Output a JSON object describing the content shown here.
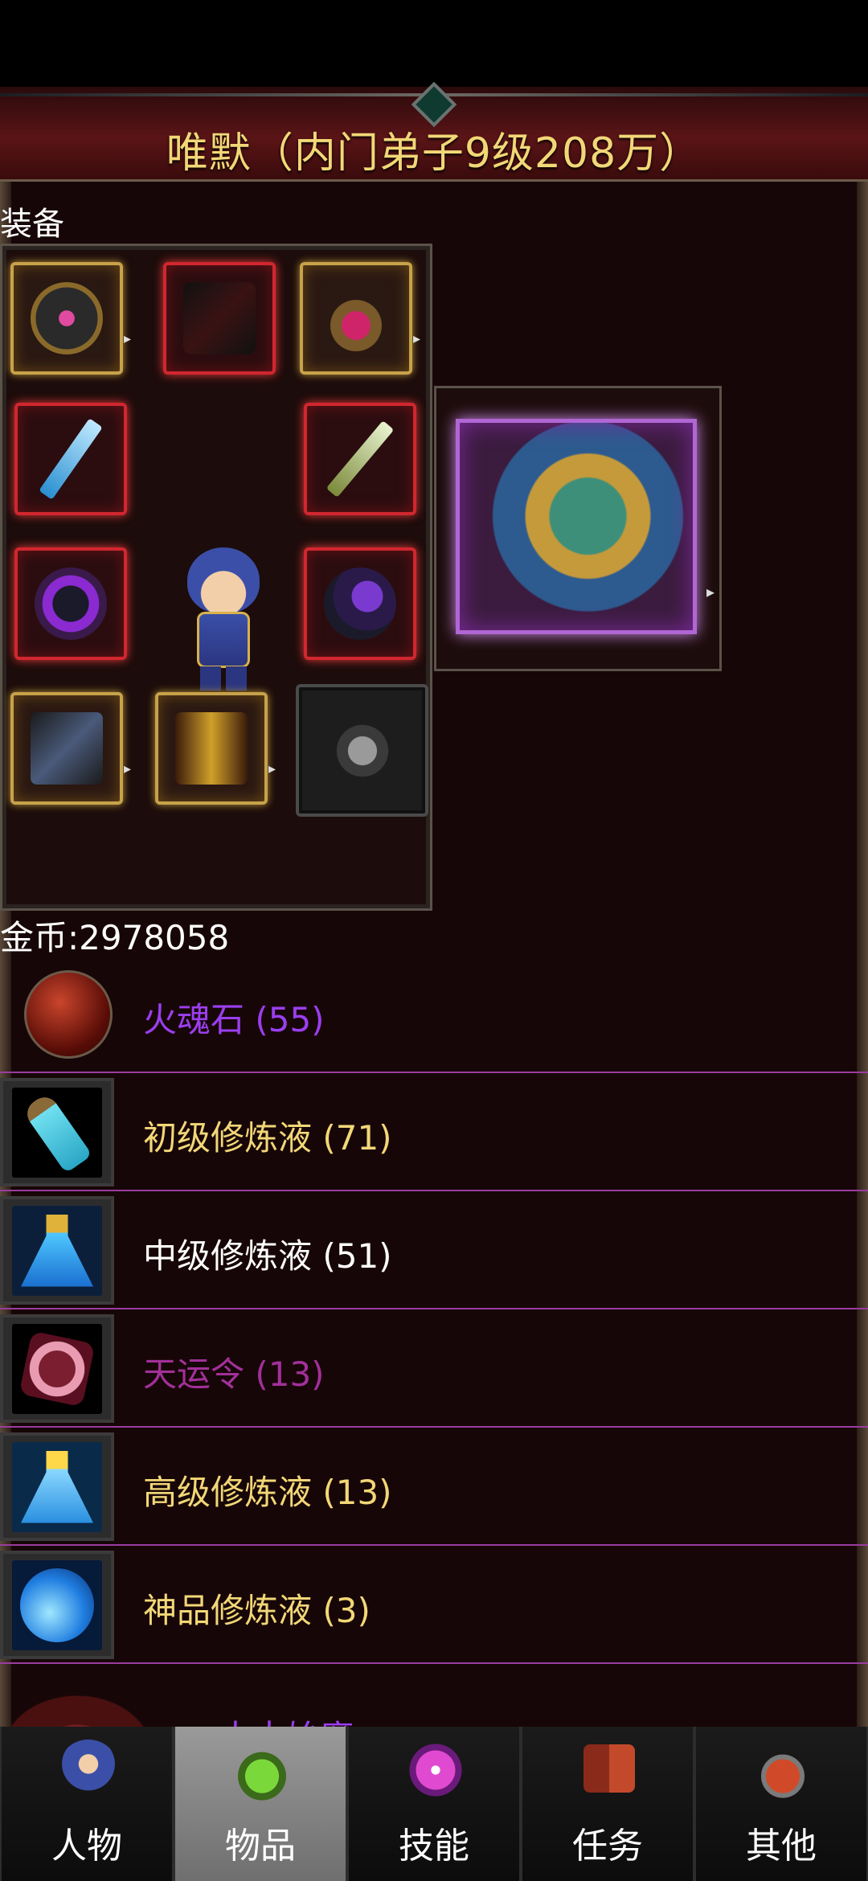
{
  "header": {
    "title": "唯默（内门弟子9级208万）"
  },
  "equipment": {
    "label": "装备"
  },
  "currency": {
    "gold_text": "金币:2978058"
  },
  "inventory": [
    {
      "name": "火魂石 (55)",
      "color": "#9b3ef0",
      "icon": "fire-soul-stone-icon"
    },
    {
      "name": "初级修炼液 (71)",
      "color": "#f2d777",
      "icon": "elixir-vial-icon"
    },
    {
      "name": "中级修炼液 (51)",
      "color": "#ffffff",
      "icon": "elixir-flask-icon"
    },
    {
      "name": "天运令 (13)",
      "color": "#a2309a",
      "icon": "fortune-token-icon"
    },
    {
      "name": "高级修炼液 (13)",
      "color": "#f2d777",
      "icon": "elixir-flask-icon"
    },
    {
      "name": "神品修炼液 (3)",
      "color": "#f2d777",
      "icon": "elixir-orb-icon"
    }
  ],
  "boss": {
    "name": "太古始魔"
  },
  "tabs": [
    {
      "label": "人物",
      "icon": "character-icon"
    },
    {
      "label": "物品",
      "icon": "potion-icon"
    },
    {
      "label": "技能",
      "icon": "skill-orb-icon"
    },
    {
      "label": "任务",
      "icon": "quest-book-icon"
    },
    {
      "label": "其他",
      "icon": "misc-icon"
    }
  ],
  "active_tab": "物品",
  "colors": {
    "background": "#170607",
    "divider": "#9a3ca0",
    "title": "#f2d777"
  }
}
